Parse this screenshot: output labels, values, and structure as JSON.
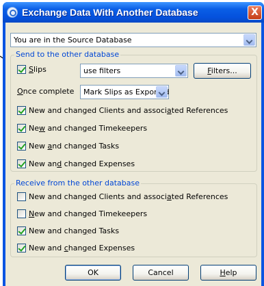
{
  "window": {
    "title": "Exchange Data With Another Database",
    "close_label": "X"
  },
  "location_select": {
    "value": "You are in the Source Database"
  },
  "send": {
    "legend": "Send to the other database",
    "slips": {
      "label_key": "S",
      "label_rest": "lips",
      "checked": true,
      "filter_value": "use filters"
    },
    "filters_button": {
      "key": "F",
      "rest": "ilters..."
    },
    "once_complete": {
      "label_key": "O",
      "label_rest": "nce complete",
      "value": "Mark Slips as Exported"
    },
    "items": [
      {
        "pre": "New and changed Clients and associ",
        "key": "a",
        "post": "ted References",
        "checked": true
      },
      {
        "pre": "Ne",
        "key": "w",
        "post": " and changed Timekeepers",
        "checked": true
      },
      {
        "pre": "New ",
        "key": "a",
        "post": "nd changed Tasks",
        "checked": true
      },
      {
        "pre": "New an",
        "key": "d",
        "post": " changed Expenses",
        "checked": true
      }
    ]
  },
  "receive": {
    "legend": "Receive from the other database",
    "items": [
      {
        "pre": "New and changed Clients and associ",
        "key": "a",
        "post": "ted References",
        "checked": false
      },
      {
        "pre": "",
        "key": "N",
        "post": "ew and changed Timekeepers",
        "checked": false
      },
      {
        "pre": "New and chan",
        "key": "g",
        "post": "ed Tasks",
        "checked": true
      },
      {
        "pre": "New and ",
        "key": "c",
        "post": "hanged Expenses",
        "checked": true
      }
    ]
  },
  "buttons": {
    "ok": "OK",
    "cancel": "Cancel",
    "help_key": "H",
    "help_rest": "elp"
  }
}
